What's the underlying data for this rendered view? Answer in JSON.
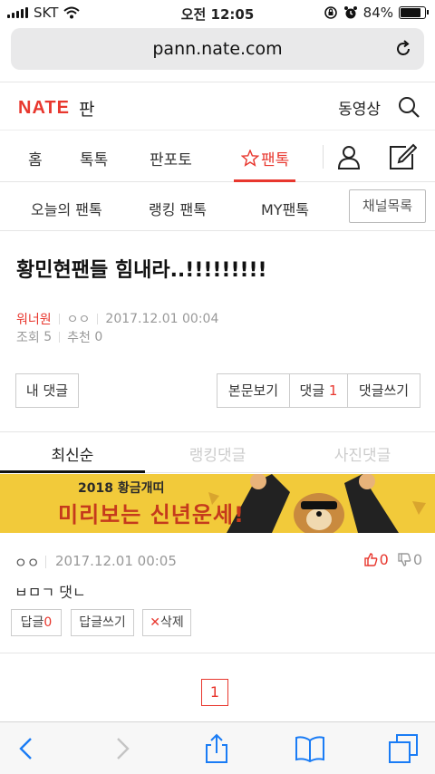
{
  "status_bar": {
    "carrier": "SKT",
    "time": "오전 12:05",
    "battery": "84%",
    "battery_level": 0.84
  },
  "browser": {
    "url": "pann.nate.com"
  },
  "header": {
    "logo": "NATE",
    "logo_sub": "판",
    "video_link": "동영상"
  },
  "main_nav": {
    "items": [
      "홈",
      "톡톡",
      "판포토",
      "팬톡"
    ],
    "active_index": 3
  },
  "sub_nav": {
    "items": [
      "오늘의 팬톡",
      "랭킹 팬톡",
      "MY팬톡"
    ],
    "channel_list": "채널목록"
  },
  "post": {
    "title": "황민현팬들 힘내라..!!!!!!!!!",
    "author": "워너원",
    "nickname": "ㅇㅇ",
    "date": "2017.12.01 00:04",
    "views_label": "조회",
    "views": "5",
    "recommend_label": "추천",
    "recommend": "0"
  },
  "actions": {
    "my_comments": "내 댓글",
    "view_body": "본문보기",
    "comments_label": "댓글",
    "comments_count": "1",
    "write_comment": "댓글쓰기"
  },
  "comment_tabs": [
    "최신순",
    "랭킹댓글",
    "사진댓글"
  ],
  "banner": {
    "year_text": "2018 황금개띠",
    "main_text": "미리보는 신년운세!"
  },
  "comments": [
    {
      "author": "ㅇㅇ",
      "date": "2017.12.01 00:05",
      "likes": "0",
      "dislikes": "0",
      "body": "ㅂㅁㄱ 댓ㄴ",
      "reply_label": "답글",
      "reply_count": "0",
      "write_reply": "답글쓰기",
      "delete_label": "삭제"
    }
  ],
  "pagination": {
    "current": "1"
  },
  "colors": {
    "accent": "#e8372e",
    "banner_bg": "#f2ca3a",
    "ios_blue": "#1a7cf5"
  }
}
